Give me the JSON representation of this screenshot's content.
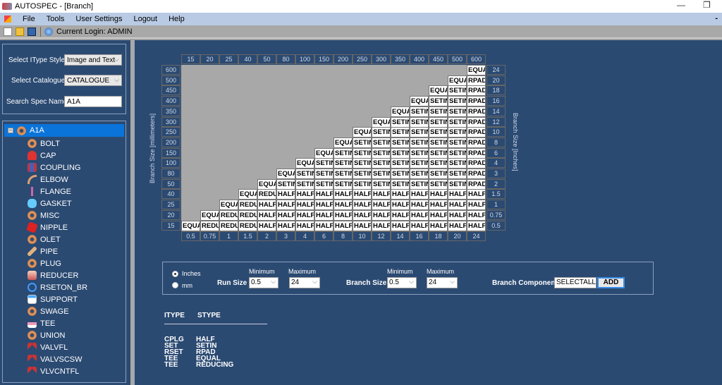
{
  "window": {
    "title": "AUTOSPEC - [Branch]",
    "minimize": "—",
    "restore": "❐"
  },
  "menu": [
    "File",
    "Tools",
    "User Settings",
    "Logout",
    "Help"
  ],
  "toolbar": {
    "login_label": "Current Login: ADMIN"
  },
  "left_panel": {
    "itype_style_label": "Select IType Style :",
    "itype_style_value": "Image and Text",
    "catalogue_label": "Select Catalogue :",
    "catalogue_value": "CATALOGUE",
    "search_label": "Search Spec Name:",
    "search_value": "A1A"
  },
  "tree": {
    "root": "A1A",
    "items": [
      {
        "label": "BOLT",
        "icon": "nut"
      },
      {
        "label": "CAP",
        "icon": "cap"
      },
      {
        "label": "COUPLING",
        "icon": "coupling"
      },
      {
        "label": "ELBOW",
        "icon": "elbow"
      },
      {
        "label": "FLANGE",
        "icon": "flange"
      },
      {
        "label": "GASKET",
        "icon": "gasket"
      },
      {
        "label": "MISC",
        "icon": "nut"
      },
      {
        "label": "NIPPLE",
        "icon": "nipple"
      },
      {
        "label": "OLET",
        "icon": "nut"
      },
      {
        "label": "PIPE",
        "icon": "pipe"
      },
      {
        "label": "PLUG",
        "icon": "nut"
      },
      {
        "label": "REDUCER",
        "icon": "reducer"
      },
      {
        "label": "RSETON_BR",
        "icon": "rseton"
      },
      {
        "label": "SUPPORT",
        "icon": "support"
      },
      {
        "label": "SWAGE",
        "icon": "nut"
      },
      {
        "label": "TEE",
        "icon": "tee"
      },
      {
        "label": "UNION",
        "icon": "nut"
      },
      {
        "label": "VALVFL",
        "icon": "valve"
      },
      {
        "label": "VALVSCSW",
        "icon": "valve"
      },
      {
        "label": "VLVCNTFL",
        "icon": "valve"
      }
    ]
  },
  "grid": {
    "left_axis_label": "Branch Size [millimeters]",
    "right_axis_label": "Branch Size [Inches]",
    "run_mm": [
      "15",
      "20",
      "25",
      "40",
      "50",
      "80",
      "100",
      "150",
      "200",
      "250",
      "300",
      "350",
      "400",
      "450",
      "500",
      "600"
    ],
    "run_in": [
      "0.5",
      "0.75",
      "1",
      "1.5",
      "2",
      "3",
      "4",
      "6",
      "8",
      "10",
      "12",
      "14",
      "16",
      "18",
      "20",
      "24"
    ],
    "branch_mm_top_down": [
      "600",
      "500",
      "450",
      "400",
      "350",
      "300",
      "250",
      "200",
      "150",
      "100",
      "80",
      "50",
      "40",
      "25",
      "20",
      "15"
    ],
    "branch_in_top_down": [
      "24",
      "20",
      "18",
      "16",
      "14",
      "12",
      "10",
      "8",
      "6",
      "4",
      "3",
      "2",
      "1.5",
      "1",
      "0.75",
      "0.5"
    ],
    "rows_bottom_up": [
      [
        "EQUA",
        "REDU",
        "REDU",
        "REDU",
        "HALF",
        "HALF",
        "HALF",
        "HALF",
        "HALF",
        "HALF",
        "HALF",
        "HALF",
        "HALF",
        "HALF",
        "HALF",
        "HALF"
      ],
      [
        "EQUA",
        "REDU",
        "REDU",
        "HALF",
        "HALF",
        "HALF",
        "HALF",
        "HALF",
        "HALF",
        "HALF",
        "HALF",
        "HALF",
        "HALF",
        "HALF",
        "HALF"
      ],
      [
        "EQUA",
        "REDU",
        "HALF",
        "HALF",
        "HALF",
        "HALF",
        "HALF",
        "HALF",
        "HALF",
        "HALF",
        "HALF",
        "HALF",
        "HALF",
        "HALF"
      ],
      [
        "EQUA",
        "REDU",
        "HALF",
        "HALF",
        "HALF",
        "HALF",
        "HALF",
        "HALF",
        "HALF",
        "HALF",
        "HALF",
        "HALF",
        "HALF"
      ],
      [
        "EQUA",
        "SETIN",
        "SETIN",
        "SETIN",
        "SETIN",
        "SETIN",
        "SETIN",
        "SETIN",
        "SETIN",
        "SETIN",
        "SETIN",
        "RPAD"
      ],
      [
        "EQUA",
        "SETIN",
        "SETIN",
        "SETIN",
        "SETIN",
        "SETIN",
        "SETIN",
        "SETIN",
        "SETIN",
        "SETIN",
        "RPAD"
      ],
      [
        "EQUA",
        "SETIN",
        "SETIN",
        "SETIN",
        "SETIN",
        "SETIN",
        "SETIN",
        "SETIN",
        "SETIN",
        "RPAD"
      ],
      [
        "EQUA",
        "SETIN",
        "SETIN",
        "SETIN",
        "SETIN",
        "SETIN",
        "SETIN",
        "SETIN",
        "RPAD"
      ],
      [
        "EQUA",
        "SETIN",
        "SETIN",
        "SETIN",
        "SETIN",
        "SETIN",
        "SETIN",
        "RPAD"
      ],
      [
        "EQUA",
        "SETIN",
        "SETIN",
        "SETIN",
        "SETIN",
        "SETIN",
        "RPAD"
      ],
      [
        "EQUA",
        "SETIN",
        "SETIN",
        "SETIN",
        "SETIN",
        "RPAD"
      ],
      [
        "EQUA",
        "SETIN",
        "SETIN",
        "SETIN",
        "RPAD"
      ],
      [
        "EQUA",
        "SETIN",
        "SETIN",
        "RPAD"
      ],
      [
        "EQUA",
        "SETIN",
        "RPAD"
      ],
      [
        "EQUA",
        "RPAD"
      ],
      [
        "EQUA"
      ]
    ]
  },
  "filter": {
    "unit_inches": "Inches",
    "unit_mm": "mm",
    "unit_selected": "Inches",
    "minimum_label": "Minimum",
    "maximum_label": "Maximum",
    "run_size_label": "Run Size",
    "run_min": "0.5",
    "run_max": "24",
    "branch_size_label": "Branch Size",
    "branch_min": "0.5",
    "branch_max": "24",
    "branch_component_label": "Branch Component",
    "branch_component_value": "SELECTALL",
    "add_label": "ADD"
  },
  "legend": {
    "headers": [
      "ITYPE",
      "STYPE"
    ],
    "rows": [
      [
        "CPLG",
        "HALF"
      ],
      [
        "SET",
        "SETIN"
      ],
      [
        "RSET",
        "RPAD"
      ],
      [
        "TEE",
        "EQUAL"
      ],
      [
        "TEE",
        "REDUCING"
      ]
    ]
  }
}
